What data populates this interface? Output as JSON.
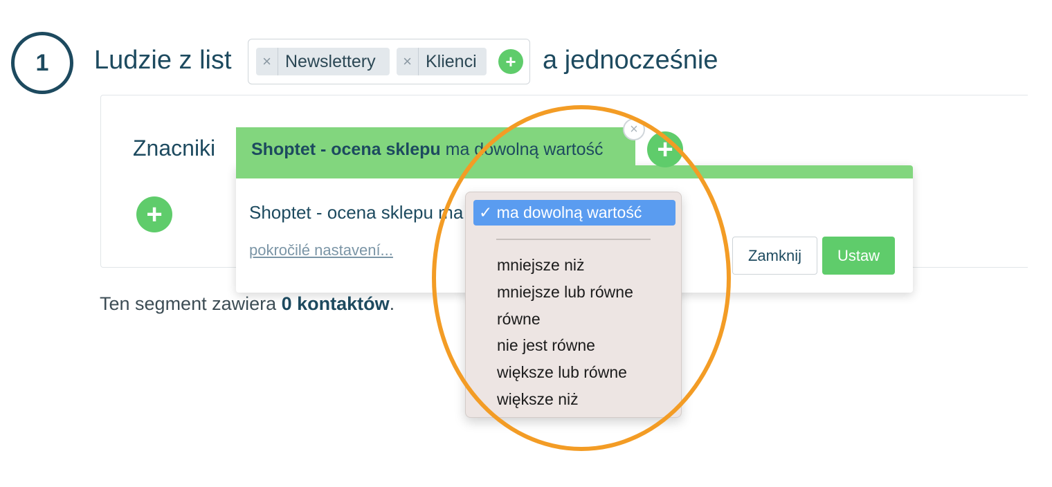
{
  "step": {
    "number": "1",
    "label": "Ludzie z list",
    "conjunction": "a jednocześnie"
  },
  "lists": [
    {
      "remove": "×",
      "name": "Newslettery"
    },
    {
      "remove": "×",
      "name": "Klienci"
    }
  ],
  "add_symbol": "+",
  "section": {
    "label": "Znacniki"
  },
  "filter": {
    "field": "Shoptet - ocena sklepu",
    "operator": "ma dowolną wartość",
    "close_symbol": "×"
  },
  "popup": {
    "prefix": "Shoptet - ocena sklepu ma",
    "advanced_link": "pokročilé nastavení...",
    "close_button": "Zamknij",
    "set_button": "Ustaw"
  },
  "summary": {
    "prefix": "Ten segment zawiera ",
    "count": "0 kontaktów",
    "suffix": "."
  },
  "dropdown": {
    "check": "✓",
    "selected": "ma dowolną wartość",
    "options": [
      "mniejsze niż",
      "mniejsze lub równe",
      "równe",
      "nie jest równe",
      "większe lub równe",
      "większe niż"
    ]
  },
  "colors": {
    "accent_green": "#5fcc6b",
    "tab_green": "#82d67e",
    "primary_text": "#1d4a5f",
    "highlight": "#f39c25",
    "selection_blue": "#5a9cf0"
  }
}
